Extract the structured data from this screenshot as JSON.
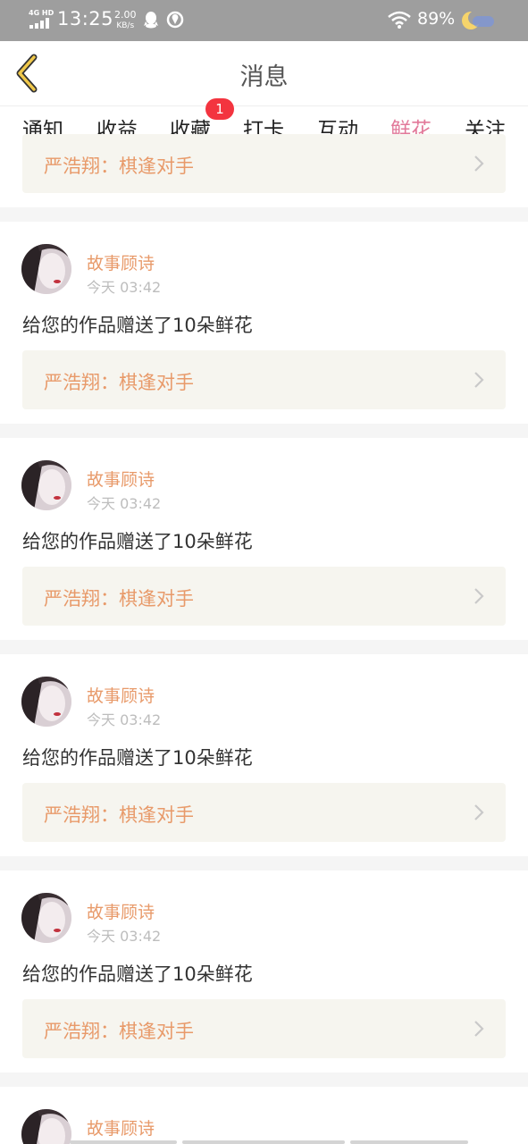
{
  "status_bar": {
    "network": "4G HD",
    "time": "13:25",
    "speed_value": "2.00",
    "speed_unit": "KB/s",
    "battery": "89%"
  },
  "header": {
    "title": "消息",
    "back_icon": "chevron-left-icon"
  },
  "tabs": [
    {
      "label": "通知"
    },
    {
      "label": "收益"
    },
    {
      "label": "收藏",
      "badge": "1"
    },
    {
      "label": "打卡"
    },
    {
      "label": "互动"
    },
    {
      "label": "鲜花",
      "active": true
    },
    {
      "label": "关注"
    }
  ],
  "partial_top_card": {
    "work_title": "严浩翔：棋逢对手"
  },
  "messages": [
    {
      "sender": "故事顾诗",
      "time": "今天 03:42",
      "text": "给您的作品赠送了10朵鲜花",
      "work_title": "严浩翔：棋逢对手"
    },
    {
      "sender": "故事顾诗",
      "time": "今天 03:42",
      "text": "给您的作品赠送了10朵鲜花",
      "work_title": "严浩翔：棋逢对手"
    },
    {
      "sender": "故事顾诗",
      "time": "今天 03:42",
      "text": "给您的作品赠送了10朵鲜花",
      "work_title": "严浩翔：棋逢对手"
    },
    {
      "sender": "故事顾诗",
      "time": "今天 03:42",
      "text": "给您的作品赠送了10朵鲜花",
      "work_title": "严浩翔：棋逢对手"
    },
    {
      "sender": "故事顾诗"
    }
  ],
  "colors": {
    "accent": "#e2799a",
    "name": "#e89a6a",
    "badge": "#f3343f",
    "status_bar": "#9e9e9e"
  }
}
